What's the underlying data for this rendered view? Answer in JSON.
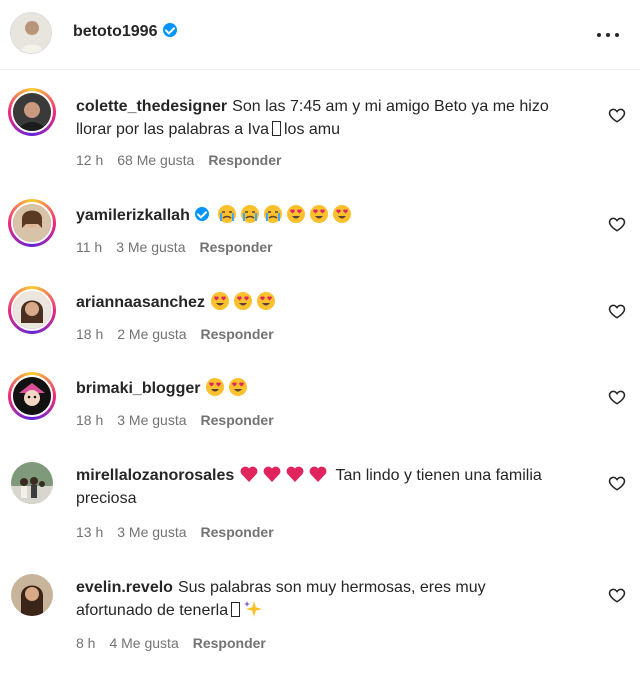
{
  "post": {
    "username": "betoto1996",
    "verified": true,
    "more_icon": "more-horizontal-icon"
  },
  "comments": [
    {
      "username": "colette_thedesigner",
      "text_before": "Son las 7:45 am y mi amigo Beto ya me hizo llorar por las palabras a Iva",
      "text_after": "los amu",
      "time": "12 h",
      "likes": "68 Me gusta",
      "reply": "Responder"
    },
    {
      "username": "yamilerizkallah",
      "verified": true,
      "emojis": [
        "crying-face",
        "crying-face",
        "crying-face",
        "heart-eyes",
        "heart-eyes",
        "heart-eyes"
      ],
      "time": "11 h",
      "likes": "3 Me gusta",
      "reply": "Responder"
    },
    {
      "username": "ariannaasanchez",
      "emojis": [
        "heart-eyes",
        "heart-eyes",
        "heart-eyes"
      ],
      "time": "18 h",
      "likes": "2 Me gusta",
      "reply": "Responder"
    },
    {
      "username": "brimaki_blogger",
      "emojis": [
        "heart-eyes",
        "heart-eyes"
      ],
      "time": "18 h",
      "likes": "3 Me gusta",
      "reply": "Responder"
    },
    {
      "username": "mirellalozanorosales",
      "emojis": [
        "red-heart",
        "red-heart",
        "red-heart",
        "red-heart"
      ],
      "text": "Tan lindo y tienen una familia preciosa",
      "time": "13 h",
      "likes": "3 Me gusta",
      "reply": "Responder"
    },
    {
      "username": "evelin.revelo",
      "text": "Sus palabras son muy hermosas, eres muy afortunado de tenerla",
      "trailing_emoji": "sparkles",
      "time": "8 h",
      "likes": "4 Me gusta",
      "reply": "Responder"
    }
  ],
  "colors": {
    "text": "#262626",
    "secondary": "#737373",
    "verified": "#0095f6",
    "heart": "#e0245e",
    "emoji_yellow": "#fbc02d"
  }
}
